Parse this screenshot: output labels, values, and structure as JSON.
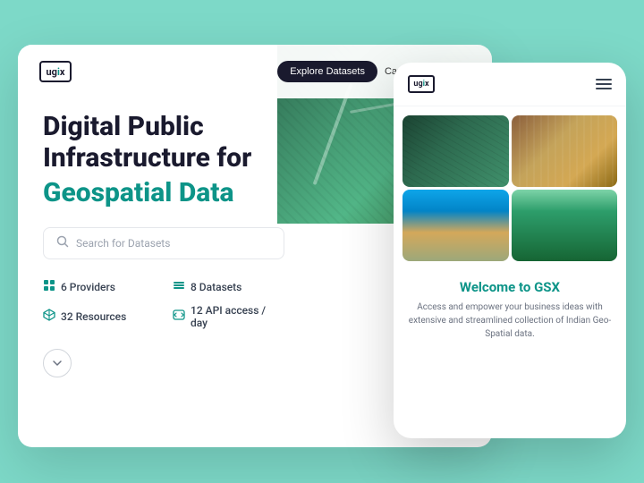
{
  "page": {
    "bg_color": "#7dd9c8"
  },
  "nav": {
    "logo_text": "ugix",
    "logo_teal": "i",
    "btn_explore": "Explore Datasets",
    "btn_canvas": "Canvas Playground"
  },
  "hero": {
    "title_line1": "Digital Public",
    "title_line2": "Infrastructure for",
    "title_teal": "Geospatial Data",
    "search_placeholder": "Search for Datasets"
  },
  "stats": [
    {
      "icon": "grid-icon",
      "value": "6 Providers"
    },
    {
      "icon": "layers-icon",
      "value": "8 Datasets"
    },
    {
      "icon": "map-icon",
      "value": "32 Resources"
    },
    {
      "icon": "api-icon",
      "value": "12 API access / day"
    }
  ],
  "mobile": {
    "logo_text": "ugix",
    "logo_teal": "i",
    "welcome_title": "Welcome to ",
    "welcome_brand": "GSX",
    "welcome_desc": "Access and empower your business ideas with extensive and streamlined collection of Indian Geo-Spatial data."
  },
  "chevron": "›"
}
